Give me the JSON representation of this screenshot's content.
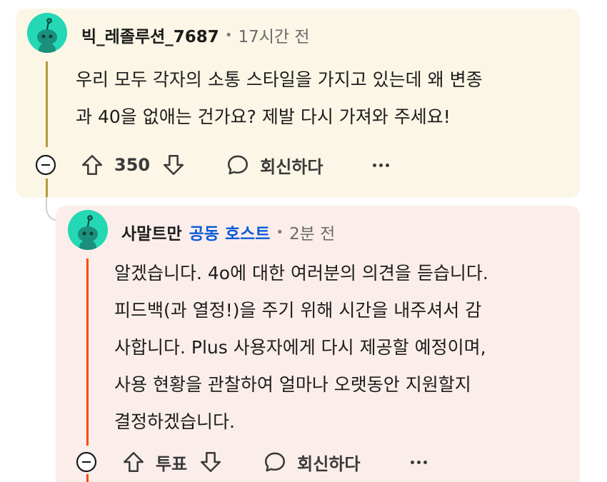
{
  "comment1": {
    "username": "빅_레졸루션_7687",
    "separator": "•",
    "time": "17시간 전",
    "lines": [
      "우리 모두 각자의 소통 스타일을 가지고 있는데 왜 변종",
      "과 40을 없애는 건가요? 제발 다시 가져와 주세요!"
    ],
    "vote_count": "350",
    "reply_label": "회신하다"
  },
  "comment2": {
    "username": "사말트만",
    "badge": "공동 호스트",
    "separator": "•",
    "time": "2분 전",
    "lines": [
      "알겠습니다. 4o에 대한 여러분의 의견을 듣습니다.",
      "피드백(과 열정!)을 주기 위해 시간을 내주셔서 감",
      "사합니다. Plus 사용자에게 다시 제공할 예정이며,",
      "사용 현황을 관찰하여 얼마나 오랫동안 지원할지",
      "결정하겠습니다."
    ],
    "vote_label": "투표",
    "reply_label": "회신하다"
  },
  "colors": {
    "card1_bg": "#fbf6e6",
    "card2_bg": "#fbeeea",
    "avatar": "#24d8b6",
    "badge": "#0a5bd8",
    "thread_gold": "#b49a3c",
    "thread_orange": "#ff4500"
  },
  "icons": [
    "avatar-snoo-icon",
    "collapse-minus-icon",
    "upvote-arrow-icon",
    "downvote-arrow-icon",
    "reply-bubble-icon",
    "more-dots-icon"
  ]
}
